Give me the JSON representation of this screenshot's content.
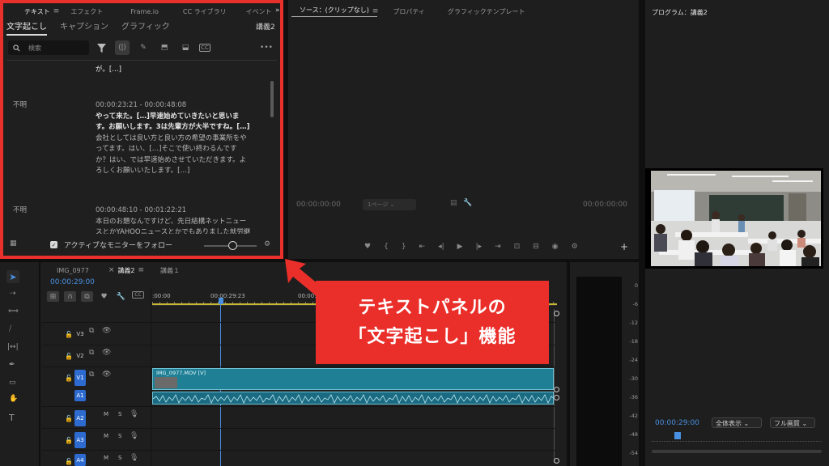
{
  "text_panel": {
    "tabs": [
      "テキスト",
      "エフェクト",
      "Frame.io",
      "CC ライブラリ",
      "イベント"
    ],
    "overflow": "»",
    "subtabs": [
      "文字起こし",
      "キャプション",
      "グラフィック"
    ],
    "sequence_name": "講義2",
    "search_placeholder": "検索",
    "top_fragment": "が。[…]",
    "segments": [
      {
        "speaker": "不明",
        "timecode": "00:00:23:21 - 00:00:48:08",
        "line1": "やって来た。[…]早速始めていきたいと思いま",
        "line2": "す。お願いします。3は先輩方が大半ですね。[…]",
        "line3": "会社としては良い方と良い方の希望の事業所をや",
        "line4": "ってます。はい、[…]そこで使い終わるんです",
        "line5": "か？はい、では早速始めさせていただきます。よ",
        "line6": "ろしくお願いいたします。[…]"
      },
      {
        "speaker": "不明",
        "timecode": "00:00:48:10 - 00:01:22:21",
        "line1": "本日のお題なんですけど、先日結構ネットニュー",
        "line2": "スとかYAHOOニュースとかでもありました就労継"
      }
    ],
    "follow_monitor_label": "アクティブなモニターをフォロー"
  },
  "source_panel": {
    "tabs": [
      "ソース：(クリップなし)",
      "プロパティ",
      "グラフィックテンプレート"
    ],
    "timecode_left": "00:00:00:00",
    "timecode_right": "00:00:00:00",
    "page_select": "1ページ"
  },
  "program_panel": {
    "title": "プログラム：講義2",
    "timecode": "00:00:29:00",
    "zoom_select": "全体表示",
    "quality_select": "フル画質"
  },
  "timeline": {
    "tabs": [
      "IMG_0977",
      "講義2",
      "講義１"
    ],
    "timecode": "00:00:29:00",
    "ruler": [
      ":00:00",
      "00:00:29:23",
      "00:00:59:22"
    ],
    "tracks": [
      "V3",
      "V2",
      "V1",
      "A1",
      "A2",
      "A3",
      "A4"
    ],
    "clip_name": "IMG_0977.MOV [V]",
    "m_label": "M",
    "s_label": "S"
  },
  "meter": {
    "scale": [
      "0",
      "-6",
      "-12",
      "-18",
      "-24",
      "-30",
      "-36",
      "-42",
      "-48",
      "-54"
    ]
  },
  "callout": {
    "line1": "テキストパネルの",
    "line2": "「文字起こし」機能"
  },
  "colors": {
    "accent_red": "#ea2f2a",
    "timecode_blue": "#4a90e2",
    "clip_teal": "#1f7f95"
  }
}
